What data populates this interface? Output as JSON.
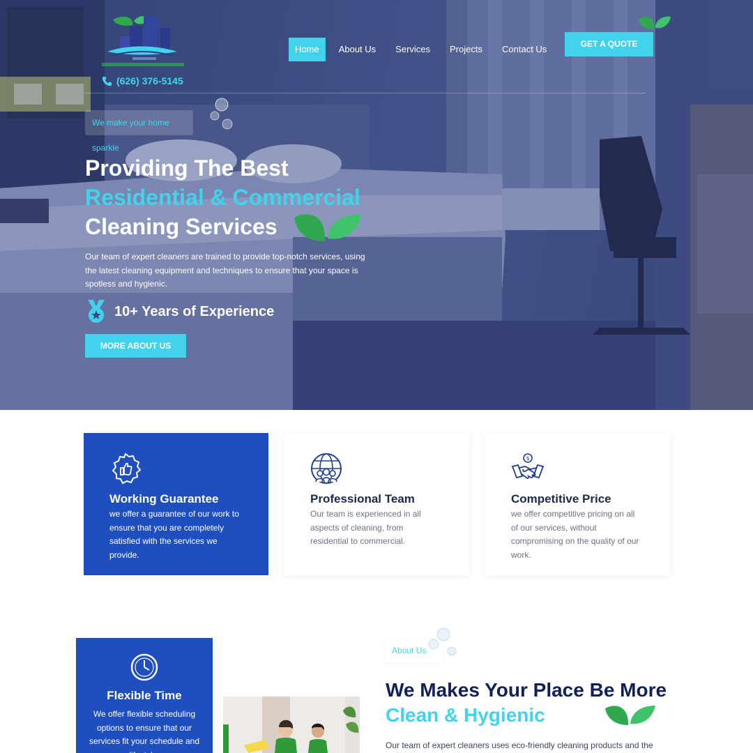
{
  "nav": {
    "phone": "(626) 376-5145",
    "items": [
      {
        "label": "Home",
        "active": true
      },
      {
        "label": "About Us",
        "active": false
      },
      {
        "label": "Services",
        "active": false
      },
      {
        "label": "Projects",
        "active": false
      },
      {
        "label": "Contact Us",
        "active": false
      }
    ],
    "quote_button": "GET A QUOTE"
  },
  "hero": {
    "tagline": "We make your home sparkle",
    "title_line1": "Providing The Best",
    "title_line2": "Residential & Commercial",
    "title_line3": "Cleaning Services",
    "description": "Our team of expert cleaners are trained to provide top-notch services, using the latest cleaning equipment and techniques to ensure that your space is spotless and hygienic.",
    "experience": "10+ Years of Experience",
    "button": "MORE ABOUT US"
  },
  "features": [
    {
      "icon": "thumbs-up-badge-icon",
      "title": "Working Guarantee",
      "description": "we offer a guarantee of our work to ensure that you are completely satisfied with the services we provide."
    },
    {
      "icon": "globe-team-icon",
      "title": "Professional Team",
      "description": "Our team is experienced in all aspects of cleaning, from residential to commercial."
    },
    {
      "icon": "handshake-icon",
      "title": "Competitive Price",
      "description": "we offer competitive pricing on all of our services, without compromising on the quality of our work."
    }
  ],
  "about": {
    "card_title": "Flexible Time",
    "card_description": "We offer flexible scheduling options to ensure that our services fit your schedule and lifestyle.",
    "tag": "About Us",
    "heading_line1": "We Makes Your Place Be More",
    "heading_line2": "Clean & Hygienic",
    "description": "Our team of expert cleaners uses eco-friendly cleaning products and the"
  },
  "colors": {
    "accent": "#43d2ec",
    "brand_blue": "#1f4fbf",
    "navy": "#12205a",
    "leaf_green": "#2fa84f"
  }
}
